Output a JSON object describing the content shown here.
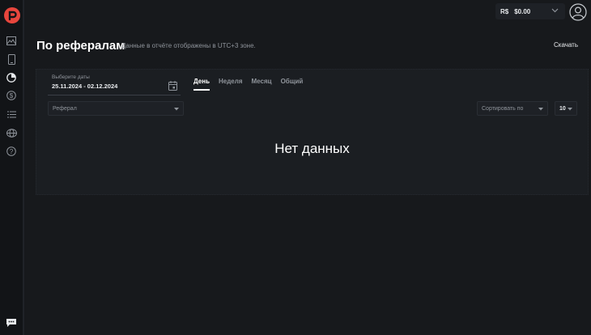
{
  "topbar": {
    "currency": "R$",
    "balance": "$0.00"
  },
  "header": {
    "title": "По рефералам",
    "subtitle": "Данные в отчёте отображены в UTC+3 зоне.",
    "download_label": "Скачать"
  },
  "filters": {
    "date_label": "Выберите даты",
    "date_value": "25.11.2024 - 02.12.2024",
    "tabs": [
      {
        "label": "День",
        "active": true
      },
      {
        "label": "Неделя",
        "active": false
      },
      {
        "label": "Месяц",
        "active": false
      },
      {
        "label": "Общий",
        "active": false
      }
    ],
    "referral_placeholder": "Реферал",
    "sort_placeholder": "Сортировать по",
    "page_size": "10"
  },
  "content": {
    "empty_text": "Нет данных"
  },
  "sidebar": {
    "icons": [
      "image-icon",
      "phone-icon",
      "pie-chart-icon",
      "dollar-icon",
      "list-icon",
      "globe-icon",
      "help-icon"
    ]
  },
  "colors": {
    "accent": "#e8463d",
    "background": "#17191c",
    "panel": "#1b1e22"
  }
}
